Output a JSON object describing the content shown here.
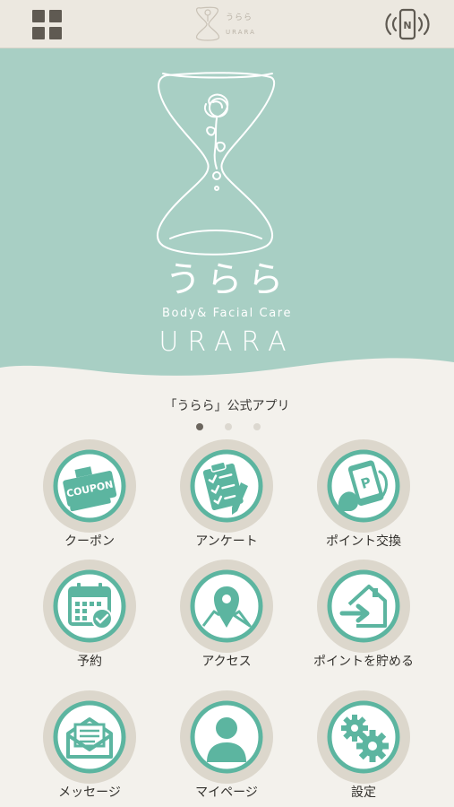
{
  "header": {
    "logo_jp": "うらら",
    "logo_en": "URARA"
  },
  "hero": {
    "brand_jp": "うらら",
    "tagline": "Body& Facial Care",
    "brand_en": "URARA"
  },
  "app_caption": "「うらら」公式アプリ",
  "pager": {
    "pages": 3,
    "active_page": 1
  },
  "menu": [
    {
      "label": "クーポン",
      "icon": "coupon-icon"
    },
    {
      "label": "アンケート",
      "icon": "clipboard-icon"
    },
    {
      "label": "ポイント交換",
      "icon": "point-exchange-icon"
    },
    {
      "label": "予約",
      "icon": "calendar-check-icon"
    },
    {
      "label": "アクセス",
      "icon": "map-pin-icon"
    },
    {
      "label": "ポイントを貯める",
      "icon": "point-checkin-icon"
    },
    {
      "label": "メッセージ",
      "icon": "mail-icon"
    },
    {
      "label": "マイページ",
      "icon": "user-icon"
    },
    {
      "label": "設定",
      "icon": "gears-icon"
    }
  ],
  "colors": {
    "accent": "#5cb5a0",
    "hero_bg": "#a8cfc4",
    "tile_circle": "#dcd7cc",
    "page_bg": "#f3f1ec",
    "topbar_bg": "#ece8e0"
  },
  "coupon_icon_text": "COUPON",
  "point_icon_text": "P"
}
